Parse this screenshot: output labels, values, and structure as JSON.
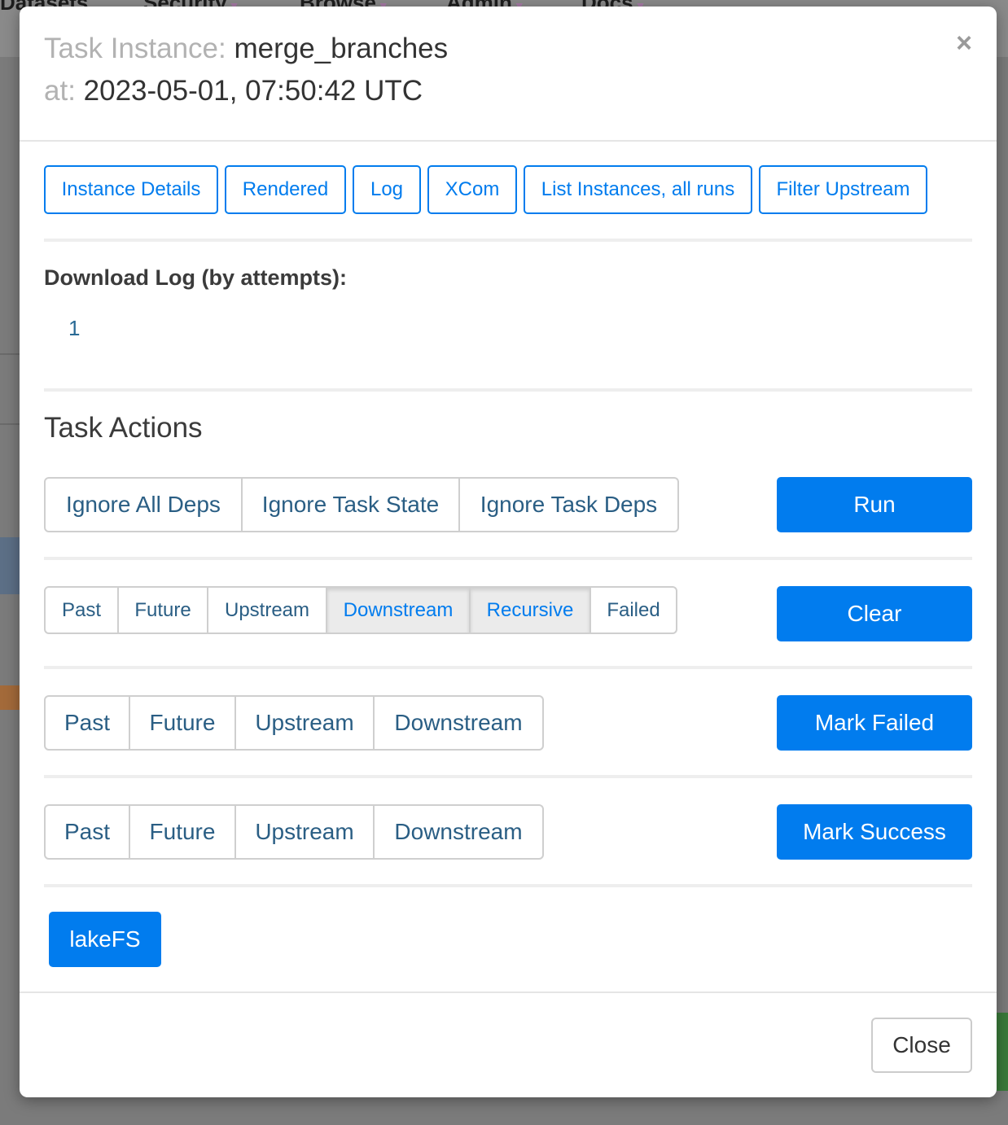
{
  "background": {
    "nav_items": [
      "Datasets",
      "Security",
      "Browse",
      "Admin",
      "Docs"
    ]
  },
  "modal": {
    "title_prefix": "Task Instance:",
    "task_id": "merge_branches",
    "at_prefix": "at:",
    "execution_time": "2023-05-01, 07:50:42 UTC",
    "close_icon": "×",
    "tabs": [
      {
        "label": "Instance Details"
      },
      {
        "label": "Rendered"
      },
      {
        "label": "Log"
      },
      {
        "label": "XCom"
      },
      {
        "label": "List Instances, all runs"
      },
      {
        "label": "Filter Upstream"
      }
    ],
    "download_log_title": "Download Log (by attempts):",
    "attempts": [
      "1"
    ],
    "task_actions_title": "Task Actions",
    "run": {
      "options": [
        "Ignore All Deps",
        "Ignore Task State",
        "Ignore Task Deps"
      ],
      "button": "Run"
    },
    "clear": {
      "options": [
        "Past",
        "Future",
        "Upstream",
        "Downstream",
        "Recursive",
        "Failed"
      ],
      "active": [
        "Downstream",
        "Recursive"
      ],
      "button": "Clear"
    },
    "mark_failed": {
      "options": [
        "Past",
        "Future",
        "Upstream",
        "Downstream"
      ],
      "button": "Mark Failed"
    },
    "mark_success": {
      "options": [
        "Past",
        "Future",
        "Upstream",
        "Downstream"
      ],
      "button": "Mark Success"
    },
    "extra_link": "lakeFS",
    "footer_close": "Close"
  },
  "colors": {
    "accent": "#017cee",
    "link": "#2a6a95"
  }
}
